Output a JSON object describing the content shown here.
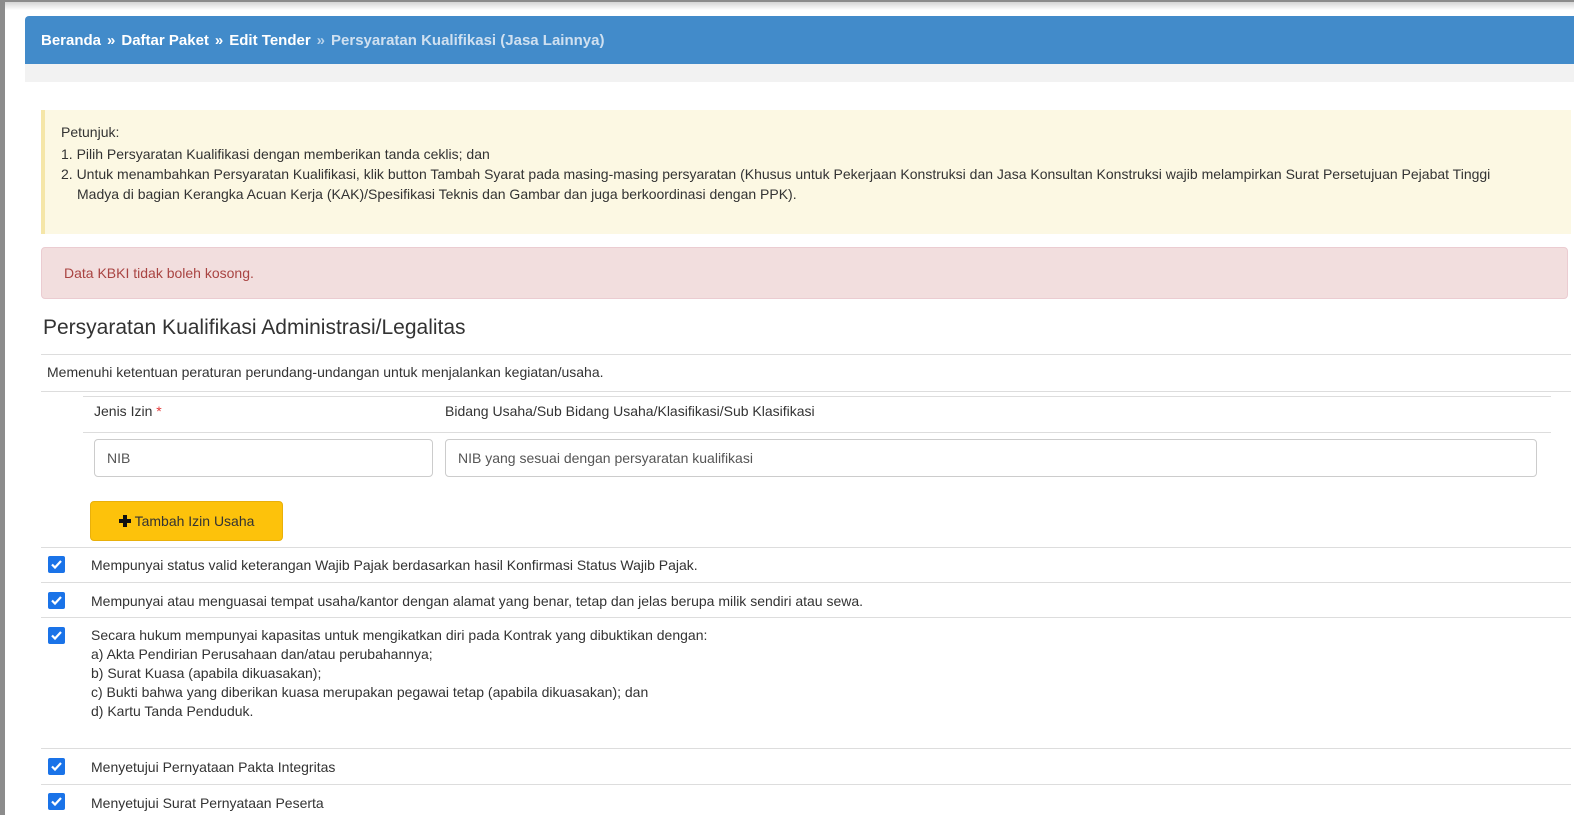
{
  "breadcrumb": {
    "home": "Beranda",
    "package_list": "Daftar Paket",
    "edit_tender": "Edit Tender",
    "current": "Persyaratan Kualifikasi (Jasa Lainnya)",
    "separator": "»"
  },
  "hint": {
    "title": "Petunjuk:",
    "items": [
      "1. Pilih Persyaratan Kualifikasi dengan memberikan tanda ceklis; dan",
      "2. Untuk menambahkan Persyaratan Kualifikasi, klik button Tambah Syarat pada masing-masing persyaratan (Khusus untuk Pekerjaan Konstruksi dan Jasa Konsultan Konstruksi wajib melampirkan Surat Persetujuan Pejabat Tinggi Madya di bagian Kerangka Acuan Kerja (KAK)/Spesifikasi Teknis dan Gambar dan juga berkoordinasi dengan PPK)."
    ]
  },
  "alert": {
    "message": "Data KBKI tidak boleh kosong."
  },
  "section": {
    "title": "Persyaratan Kualifikasi Administrasi/Legalitas",
    "legal_text": "Memenuhi ketentuan peraturan perundang-undangan untuk menjalankan kegiatan/usaha.",
    "col_license": "Jenis Izin",
    "required_mark": "*",
    "col_field": "Bidang Usaha/Sub Bidang Usaha/Klasifikasi/Sub Klasifikasi",
    "license_value": "NIB",
    "field_value": "NIB yang sesuai dengan persyaratan kualifikasi",
    "add_button": "Tambah Izin Usaha"
  },
  "requirements": [
    {
      "checked": true,
      "lines": [
        "Mempunyai status valid keterangan Wajib Pajak berdasarkan hasil Konfirmasi Status Wajib Pajak."
      ]
    },
    {
      "checked": true,
      "lines": [
        "Mempunyai atau menguasai tempat usaha/kantor dengan alamat yang benar, tetap dan jelas berupa milik sendiri atau sewa."
      ]
    },
    {
      "checked": true,
      "lines": [
        "Secara hukum mempunyai kapasitas untuk mengikatkan diri pada Kontrak yang dibuktikan dengan:",
        "a) Akta Pendirian Perusahaan dan/atau perubahannya;",
        "b) Surat Kuasa (apabila dikuasakan);",
        "c) Bukti bahwa yang diberikan kuasa merupakan pegawai tetap (apabila dikuasakan); dan",
        "d) Kartu Tanda Penduduk."
      ]
    },
    {
      "checked": true,
      "lines": [
        "Menyetujui Pernyataan Pakta Integritas"
      ]
    },
    {
      "checked": true,
      "lines": [
        "Menyetujui Surat Pernyataan Peserta"
      ]
    }
  ],
  "colors": {
    "header": "#428bca",
    "hint_bg": "#fcf8e3",
    "alert_bg": "#f2dede",
    "alert_text": "#a94442",
    "button": "#fdc20b",
    "checkbox": "#1a73e8"
  }
}
